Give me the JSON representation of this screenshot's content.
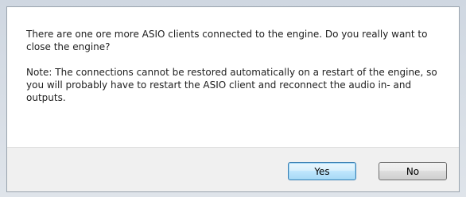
{
  "dialog": {
    "message": "There are one ore more ASIO clients connected to the engine. Do you really want to close the engine?",
    "note": "Note: The connections cannot be restored automatically on a restart of the engine, so you will probably have to restart the ASIO client and reconnect the audio in- and outputs.",
    "buttons": {
      "yes": "Yes",
      "no": "No"
    }
  }
}
